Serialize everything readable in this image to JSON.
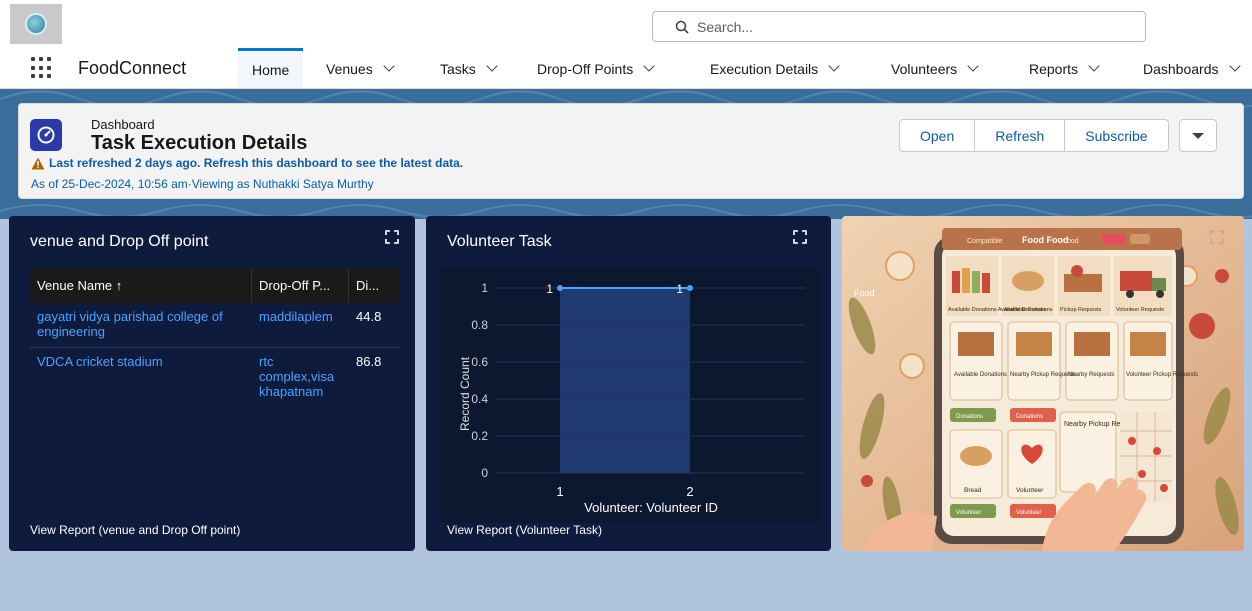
{
  "header": {
    "search_placeholder": "Search..."
  },
  "nav": {
    "app_name": "FoodConnect",
    "tabs": [
      {
        "label": "Home",
        "active": true
      },
      {
        "label": "Venues"
      },
      {
        "label": "Tasks"
      },
      {
        "label": "Drop-Off Points"
      },
      {
        "label": "Execution Details"
      },
      {
        "label": "Volunteers"
      },
      {
        "label": "Reports"
      },
      {
        "label": "Dashboards"
      }
    ]
  },
  "dashboard": {
    "label": "Dashboard",
    "title": "Task Execution Details",
    "warning": "Last refreshed 2 days ago. Refresh this dashboard to see the latest data.",
    "as_of": "As of 25-Dec-2024, 10:56 am·Viewing as Nuthakki Satya Murthy",
    "buttons": {
      "open": "Open",
      "refresh": "Refresh",
      "subscribe": "Subscribe"
    }
  },
  "widget_table": {
    "title": "venue and Drop Off point",
    "columns": [
      "Venue Name ↑",
      "Drop-Off P...",
      "Di..."
    ],
    "rows": [
      {
        "venue": "gayatri vidya parishad college of engineering",
        "dropoff": "maddilaplem",
        "dist": "44.8"
      },
      {
        "venue": "VDCA cricket stadium",
        "dropoff": "rtc complex,visa khapatnam",
        "dist": "86.8"
      }
    ],
    "footer": "View Report (venue and Drop Off point)"
  },
  "widget_chart": {
    "title": "Volunteer Task",
    "footer": "View Report (Volunteer Task)"
  },
  "chart_data": {
    "type": "line",
    "categories": [
      "1",
      "2"
    ],
    "series": [
      {
        "values": [
          1,
          1
        ]
      }
    ],
    "data_labels": [
      "1",
      "1"
    ],
    "xlabel": "Volunteer: Volunteer ID",
    "ylabel": "Record Count",
    "yticks": [
      "0",
      "0.2",
      "0.4",
      "0.6",
      "0.8",
      "1"
    ],
    "ylim": [
      0,
      1
    ],
    "grid": true,
    "colors": {
      "line": "#4aa3ff",
      "band": "#1e3a70"
    }
  },
  "widget_image": {
    "text": {
      "header_app": "Compatible",
      "header_title": "Food Food",
      "header_suffix": "ood",
      "side_label": "Food",
      "top_labels": [
        "Available Donations Available Donations",
        "Available Donations",
        "Pickup Requests",
        "Volunteer Requests"
      ],
      "mid_labels": [
        "Available Donations",
        "Nearby Pickup Requests",
        "Nearby Requests",
        "Volunteer Pickup Requests"
      ],
      "buttons_row1": [
        "Donations",
        "Donations"
      ],
      "nearby_card": "Nearby Pickup Request",
      "bottom_labels": [
        "Bread",
        "Volunteer"
      ],
      "buttons_row2": [
        "Volunteer",
        "Volunteer"
      ]
    }
  }
}
